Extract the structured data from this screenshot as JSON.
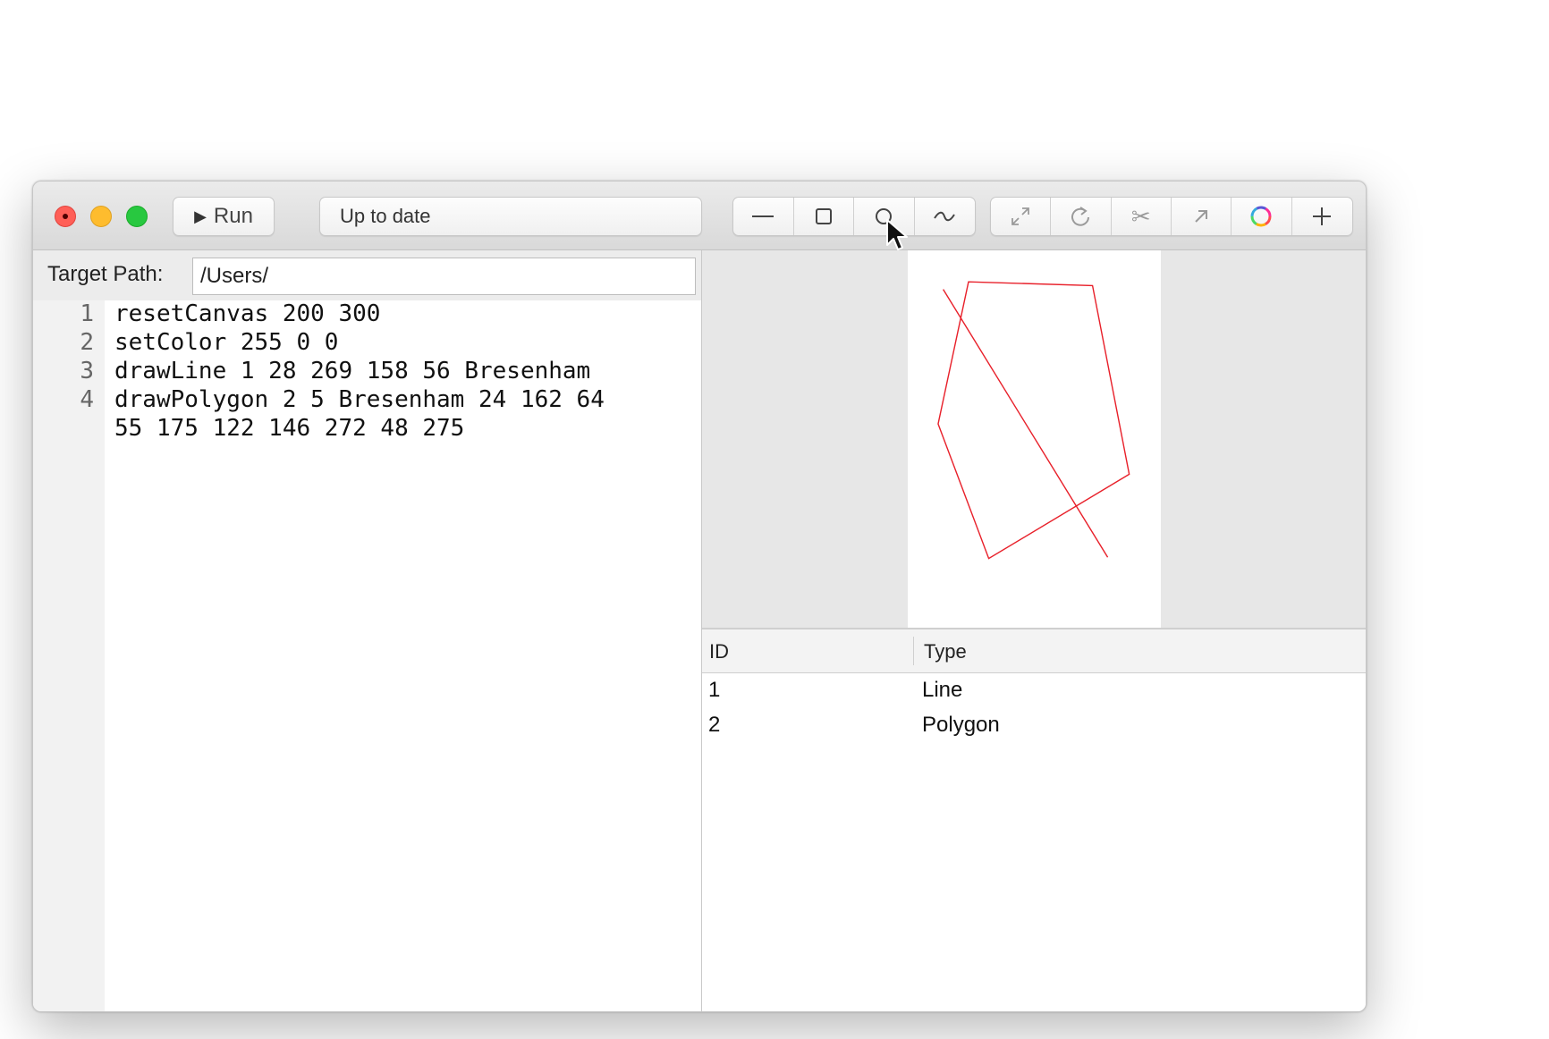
{
  "toolbar": {
    "run_label": "Run",
    "status_text": "Up to date",
    "draw_tools": [
      "line-tool",
      "rectangle-tool",
      "ellipse-tool",
      "curve-tool"
    ],
    "edit_tools": [
      "scale-tool",
      "rotate-tool",
      "clip-tool",
      "translate-tool",
      "color-picker",
      "add-tool"
    ]
  },
  "target_path": {
    "label": "Target Path:",
    "value": "/Users/"
  },
  "editor": {
    "line_numbers": [
      "1",
      "2",
      "3",
      "4"
    ],
    "lines": [
      "resetCanvas 200 300",
      "setColor 255 0 0",
      "drawLine 1 28 269 158 56 Bresenham",
      "drawPolygon 2 5 Bresenham 24 162 64",
      "55 175 122 146 272 48 275"
    ]
  },
  "canvas": {
    "stroke_color": "#e8202a",
    "width": 200,
    "height": 300
  },
  "shape_table": {
    "headers": {
      "id": "ID",
      "type": "Type"
    },
    "rows": [
      {
        "id": "1",
        "type": "Line"
      },
      {
        "id": "2",
        "type": "Polygon"
      }
    ]
  }
}
